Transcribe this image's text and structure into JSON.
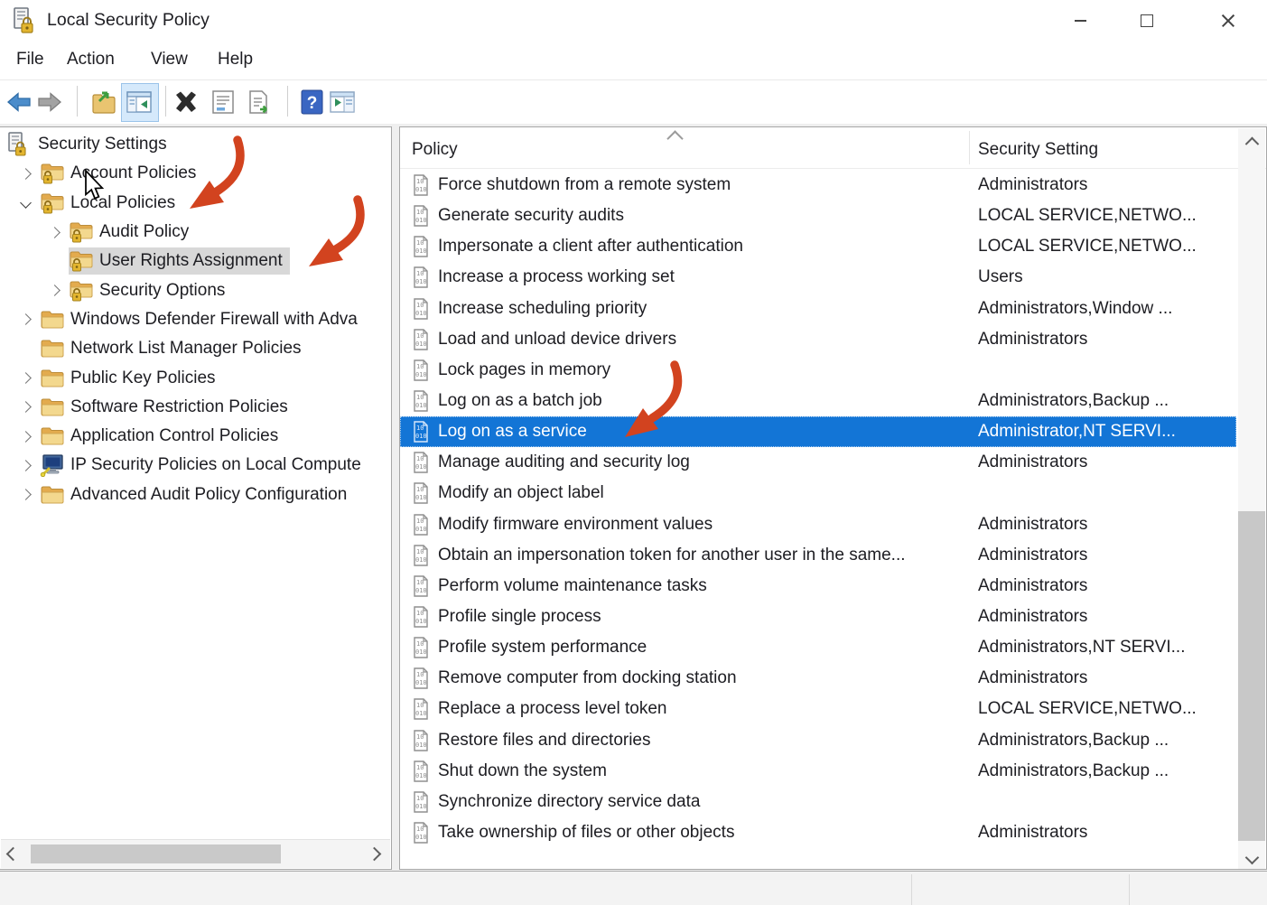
{
  "window": {
    "title": "Local Security Policy",
    "controls": [
      "minimize",
      "maximize",
      "close"
    ]
  },
  "menu": {
    "items": [
      "File",
      "Action",
      "View",
      "Help"
    ]
  },
  "toolbar": {
    "buttons": [
      "back",
      "forward",
      "up-one-level",
      "show-hide-console-tree",
      "delete",
      "properties",
      "export-list",
      "help",
      "show-hide-action-pane"
    ]
  },
  "tree": {
    "items": [
      {
        "label": "Security Settings",
        "level": 0,
        "icon": "console-root",
        "expander": "none"
      },
      {
        "label": "Account Policies",
        "level": 1,
        "icon": "folder-lock",
        "expander": "collapsed"
      },
      {
        "label": "Local Policies",
        "level": 1,
        "icon": "folder-lock",
        "expander": "expanded"
      },
      {
        "label": "Audit Policy",
        "level": 2,
        "icon": "folder-lock",
        "expander": "collapsed"
      },
      {
        "label": "User Rights Assignment",
        "level": 2,
        "icon": "folder-lock",
        "expander": "none",
        "selected": true
      },
      {
        "label": "Security Options",
        "level": 2,
        "icon": "folder-lock",
        "expander": "collapsed"
      },
      {
        "label": "Windows Defender Firewall with Adva",
        "level": 1,
        "icon": "folder",
        "expander": "collapsed"
      },
      {
        "label": "Network List Manager Policies",
        "level": 1,
        "icon": "folder",
        "expander": "none"
      },
      {
        "label": "Public Key Policies",
        "level": 1,
        "icon": "folder",
        "expander": "collapsed"
      },
      {
        "label": "Software Restriction Policies",
        "level": 1,
        "icon": "folder",
        "expander": "collapsed"
      },
      {
        "label": "Application Control Policies",
        "level": 1,
        "icon": "folder",
        "expander": "collapsed"
      },
      {
        "label": "IP Security Policies on Local Compute",
        "level": 1,
        "icon": "computer",
        "expander": "collapsed"
      },
      {
        "label": "Advanced Audit Policy Configuration",
        "level": 1,
        "icon": "folder",
        "expander": "collapsed"
      }
    ]
  },
  "list": {
    "columns": [
      "Policy",
      "Security Setting"
    ],
    "rows": [
      {
        "policy": "Force shutdown from a remote system",
        "setting": "Administrators"
      },
      {
        "policy": "Generate security audits",
        "setting": "LOCAL SERVICE,NETWO..."
      },
      {
        "policy": "Impersonate a client after authentication",
        "setting": "LOCAL SERVICE,NETWO..."
      },
      {
        "policy": "Increase a process working set",
        "setting": "Users"
      },
      {
        "policy": "Increase scheduling priority",
        "setting": "Administrators,Window ..."
      },
      {
        "policy": "Load and unload device drivers",
        "setting": "Administrators"
      },
      {
        "policy": "Lock pages in memory",
        "setting": ""
      },
      {
        "policy": "Log on as a batch job",
        "setting": "Administrators,Backup ..."
      },
      {
        "policy": "Log on as a service",
        "setting": "Administrator,NT SERVI...",
        "selected": true
      },
      {
        "policy": "Manage auditing and security log",
        "setting": "Administrators"
      },
      {
        "policy": "Modify an object label",
        "setting": ""
      },
      {
        "policy": "Modify firmware environment values",
        "setting": "Administrators"
      },
      {
        "policy": "Obtain an impersonation token for another user in the same...",
        "setting": "Administrators"
      },
      {
        "policy": "Perform volume maintenance tasks",
        "setting": "Administrators"
      },
      {
        "policy": "Profile single process",
        "setting": "Administrators"
      },
      {
        "policy": "Profile system performance",
        "setting": "Administrators,NT SERVI..."
      },
      {
        "policy": "Remove computer from docking station",
        "setting": "Administrators"
      },
      {
        "policy": "Replace a process level token",
        "setting": "LOCAL SERVICE,NETWO..."
      },
      {
        "policy": "Restore files and directories",
        "setting": "Administrators,Backup ..."
      },
      {
        "policy": "Shut down the system",
        "setting": "Administrators,Backup ..."
      },
      {
        "policy": "Synchronize directory service data",
        "setting": ""
      },
      {
        "policy": "Take ownership of files or other objects",
        "setting": "Administrators"
      }
    ]
  },
  "annotations": {
    "arrow_color": "#d2431f",
    "arrows": [
      "points-to-local-policies",
      "points-to-user-rights-assignment",
      "points-to-log-on-as-a-service"
    ],
    "pointer_over": "Account Policies"
  },
  "colors": {
    "selection_blue": "#1375d6",
    "tree_inactive_selection": "#d8d8d8",
    "toolbar_highlight": "#d5e9fb"
  }
}
